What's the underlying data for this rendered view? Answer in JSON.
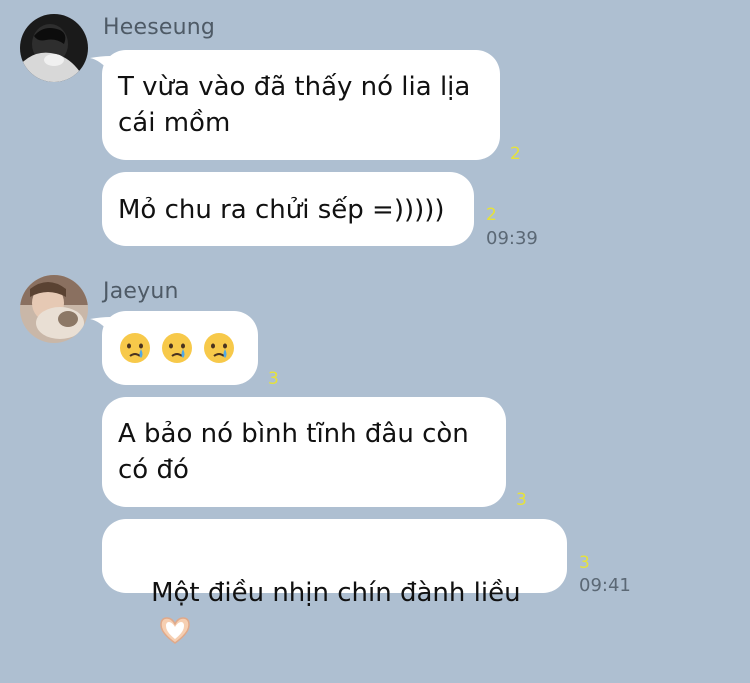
{
  "chat": {
    "groups": [
      {
        "sender": "Heeseung",
        "messages": [
          {
            "text": "T vừa vào đã thấy nó lia lịa\ncái mồm",
            "read_count": "2",
            "time": ""
          },
          {
            "text": "Mỏ chu ra chửi sếp =)))))",
            "read_count": "2",
            "time": "09:39"
          }
        ]
      },
      {
        "sender": "Jaeyun",
        "messages": [
          {
            "emojis": [
              "crying-face-emoji",
              "crying-face-emoji",
              "crying-face-emoji"
            ],
            "read_count": "3",
            "time": ""
          },
          {
            "text": "A bảo nó bình tĩnh đâu còn\ncó đó",
            "read_count": "3",
            "time": ""
          },
          {
            "text": "Một điều nhịn chín đành liều",
            "emoji": "heart-hands-emoji",
            "read_count": "3",
            "time": "09:41"
          }
        ]
      }
    ]
  },
  "colors": {
    "background": "#aebfd1",
    "bubble": "#ffffff",
    "read_count": "#e6e23a",
    "time": "#5b6875"
  }
}
